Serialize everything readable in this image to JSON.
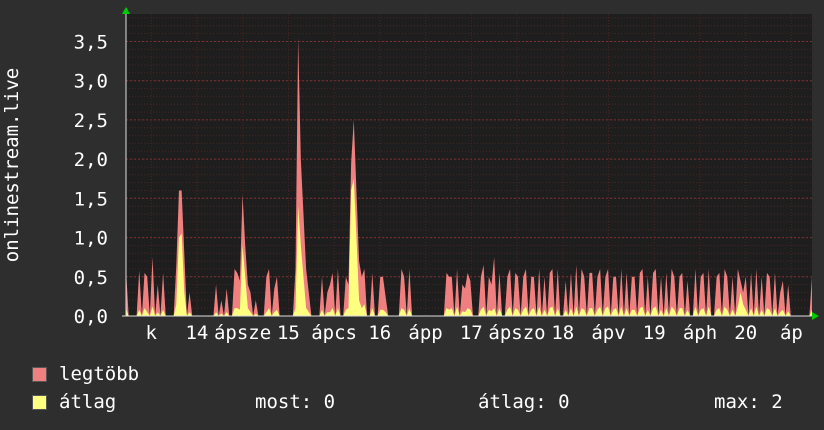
{
  "chart_data": {
    "type": "area",
    "ylabel": "onlinestream.live",
    "ylim": [
      0,
      3.85
    ],
    "yticks": [
      {
        "value": 0,
        "label": "0,0"
      },
      {
        "value": 0.5,
        "label": "0,5"
      },
      {
        "value": 1.0,
        "label": "1,0"
      },
      {
        "value": 1.5,
        "label": "1,5"
      },
      {
        "value": 2.0,
        "label": "2,0"
      },
      {
        "value": 2.5,
        "label": "2,5"
      },
      {
        "value": 3.0,
        "label": "3,0"
      },
      {
        "value": 3.5,
        "label": "3,5"
      }
    ],
    "xticks": [
      "k",
      "14",
      "ápsze",
      "15",
      "ápcs",
      "16",
      "ápp",
      "17",
      "ápszo",
      "18",
      "ápv",
      "19",
      "áph",
      "20",
      "áp"
    ],
    "grid": true,
    "legend_position": "bottom-left",
    "series": [
      {
        "name": "legtöbb",
        "color": "#f08080",
        "values": [
          0.6,
          0,
          0,
          0,
          0,
          0.58,
          0,
          0.55,
          0.5,
          0,
          0.75,
          0,
          0.4,
          0,
          0.55,
          0,
          0,
          0,
          0,
          0.65,
          1.6,
          1.6,
          0.8,
          0,
          0.3,
          0,
          0,
          0,
          0,
          0,
          0,
          0,
          0,
          0,
          0.4,
          0,
          0.2,
          0,
          0.35,
          0,
          0,
          0.6,
          0.55,
          0.45,
          1.55,
          0.9,
          0.4,
          0.3,
          0,
          0.2,
          0,
          0,
          0,
          0.5,
          0.6,
          0,
          0.35,
          0.5,
          0,
          0,
          0,
          0,
          0,
          0,
          0.6,
          3.55,
          2,
          1.3,
          0.6,
          0.3,
          0,
          0,
          0,
          0,
          0.5,
          0,
          0.3,
          0.4,
          0.55,
          0,
          0.6,
          0,
          0,
          0.5,
          0.4,
          1.95,
          2.5,
          1.6,
          0.7,
          0.5,
          0.6,
          0,
          0,
          0.55,
          0,
          0,
          0.5,
          0.5,
          0.25,
          0,
          0,
          0,
          0,
          0,
          0.6,
          0.5,
          0,
          0.6,
          0,
          0,
          0,
          0,
          0,
          0,
          0,
          0,
          0,
          0,
          0,
          0,
          0,
          0.55,
          0.5,
          0.5,
          0,
          0.6,
          0,
          0.4,
          0.35,
          0.55,
          0.45,
          0,
          0,
          0,
          0.5,
          0.65,
          0,
          0.5,
          0.4,
          0.75,
          0,
          0.55,
          0,
          0,
          0.5,
          0.6,
          0,
          0.55,
          0.5,
          0,
          0.5,
          0.6,
          0,
          0.5,
          0.5,
          0,
          0.6,
          0,
          0.5,
          0,
          0.55,
          0.6,
          0,
          0.6,
          0,
          0,
          0.45,
          0,
          0.55,
          0,
          0.65,
          0,
          0.6,
          0.5,
          0,
          0.55,
          0.55,
          0,
          0.5,
          0.6,
          0,
          0.5,
          0.6,
          0,
          0.5,
          0.5,
          0,
          0.6,
          0,
          0.55,
          0,
          0.5,
          0.5,
          0,
          0.55,
          0.6,
          0,
          0.5,
          0,
          0.55,
          0.6,
          0,
          0.5,
          0,
          0.55,
          0,
          0.6,
          0.5,
          0,
          0.5,
          0.55,
          0,
          0.45,
          0,
          0,
          0.6,
          0,
          0.5,
          0.55,
          0,
          0.6,
          0,
          0,
          0.5,
          0.55,
          0,
          0.6,
          0.5,
          0,
          0.5,
          0,
          0.6,
          0.45,
          0.3,
          0.5,
          0,
          0.55,
          0,
          0.6,
          0,
          0.5,
          0,
          0.55,
          0.5,
          0,
          0.55,
          0,
          0.3,
          0.45,
          0,
          0.4,
          0,
          0,
          0,
          0,
          0,
          0,
          0,
          0,
          0.5
        ]
      },
      {
        "name": "átlag",
        "color": "#ffff80",
        "values": [
          0.1,
          0,
          0,
          0,
          0,
          0.08,
          0,
          0.1,
          0.05,
          0,
          0.12,
          0,
          0.05,
          0,
          0.08,
          0,
          0,
          0,
          0,
          0.15,
          1.0,
          1.05,
          0.3,
          0,
          0.05,
          0,
          0,
          0,
          0,
          0,
          0,
          0,
          0,
          0,
          0.05,
          0,
          0.03,
          0,
          0.05,
          0,
          0,
          0.1,
          0.1,
          0.08,
          0.9,
          0.5,
          0.1,
          0.05,
          0,
          0.03,
          0,
          0,
          0,
          0.05,
          0.1,
          0,
          0.05,
          0.08,
          0,
          0,
          0,
          0,
          0,
          0,
          0.1,
          1.4,
          0.9,
          0.5,
          0.1,
          0.05,
          0,
          0,
          0,
          0,
          0.08,
          0,
          0.05,
          0.05,
          0.1,
          0,
          0.1,
          0,
          0,
          0.08,
          0.1,
          1.6,
          1.75,
          1.0,
          0.2,
          0.1,
          0.15,
          0,
          0,
          0.1,
          0,
          0,
          0.08,
          0.08,
          0.05,
          0,
          0,
          0,
          0,
          0,
          0.1,
          0.08,
          0,
          0.1,
          0,
          0,
          0,
          0,
          0,
          0,
          0,
          0,
          0,
          0,
          0,
          0,
          0,
          0.1,
          0.08,
          0.1,
          0,
          0.12,
          0,
          0.06,
          0.05,
          0.1,
          0.08,
          0,
          0,
          0,
          0.08,
          0.12,
          0,
          0.08,
          0.06,
          0.1,
          0,
          0.1,
          0,
          0,
          0.08,
          0.12,
          0,
          0.1,
          0.08,
          0,
          0.08,
          0.12,
          0,
          0.08,
          0.1,
          0,
          0.12,
          0,
          0.08,
          0,
          0.1,
          0.12,
          0,
          0.1,
          0,
          0,
          0.08,
          0,
          0.1,
          0,
          0.12,
          0,
          0.1,
          0.08,
          0,
          0.1,
          0.1,
          0,
          0.08,
          0.12,
          0,
          0.1,
          0.12,
          0,
          0.08,
          0.1,
          0,
          0.12,
          0,
          0.1,
          0,
          0.08,
          0.08,
          0,
          0.1,
          0.12,
          0,
          0.08,
          0,
          0.1,
          0.12,
          0,
          0.08,
          0,
          0.1,
          0,
          0.12,
          0.08,
          0,
          0.1,
          0.1,
          0,
          0.08,
          0,
          0,
          0.12,
          0,
          0.08,
          0.1,
          0,
          0.12,
          0,
          0,
          0.08,
          0.1,
          0,
          0.12,
          0.08,
          0,
          0.08,
          0,
          0.12,
          0.3,
          0.15,
          0.08,
          0,
          0.1,
          0,
          0.12,
          0,
          0.08,
          0,
          0.1,
          0.08,
          0,
          0.1,
          0,
          0.05,
          0.08,
          0,
          0.06,
          0,
          0,
          0,
          0,
          0,
          0,
          0,
          0,
          0.08
        ]
      }
    ]
  },
  "legend": {
    "max_label": "legtöbb",
    "avg_label": "átlag"
  },
  "stats": {
    "now": "most: 0",
    "avg": "átlag: 0",
    "max": "max: 2"
  },
  "colors": {
    "background": "#2e2e2e",
    "plot_background": "#1e1e1e",
    "grid": "#5a2a2a",
    "axis": "#00cc00",
    "max_series": "#f08080",
    "avg_series": "#ffff80"
  }
}
